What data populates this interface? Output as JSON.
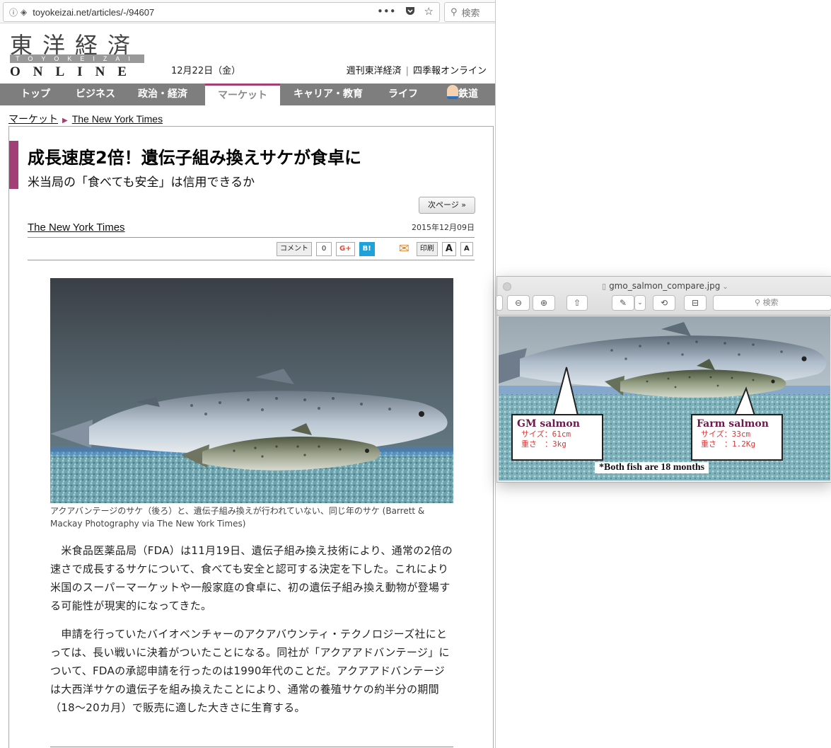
{
  "browser": {
    "url": "toyokeizai.net/articles/-/94607",
    "search_placeholder": "検索",
    "icons": [
      "info-icon",
      "shield-icon",
      "more-icon",
      "pocket-icon",
      "star-icon",
      "search-icon"
    ],
    "more_glyph": "•••"
  },
  "site": {
    "logo_kanji": "東洋経済",
    "logo_band": "TOYOKEIZAI",
    "logo_online": "ONLINE",
    "date": "12月22日（金）",
    "top_links": [
      "週刊東洋経済",
      "四季報オンライン"
    ],
    "nav": [
      "トップ",
      "ビジネス",
      "政治・経済",
      "マーケット",
      "キャリア・教育",
      "ライフ",
      "鉄道"
    ],
    "nav_active_index": 3,
    "accent_color": "#a23f77"
  },
  "breadcrumb": [
    "マーケット",
    "The New York Times"
  ],
  "article": {
    "title": "成長速度2倍！遺伝子組み換えサケが食卓に",
    "subtitle": "米当局の「食べても安全」は信用できるか",
    "next_page": "次ページ »",
    "source": "The New York Times",
    "date": "2015年12月09日",
    "share": {
      "comment": "コメント",
      "comment_count": "0",
      "gplus": "G+",
      "hatena": "B!",
      "print": "印刷",
      "font_large": "A",
      "font_small": "A"
    },
    "caption": "アクアバンテージのサケ（後ろ）と、遺伝子組み換えが行われていない、同じ年のサケ (Barrett & Mackay Photography via The New York Times)",
    "paragraphs": [
      "米食品医薬品局（FDA）は11月19日、遺伝子組み換え技術により、通常の2倍の速さで成長するサケについて、食べても安全と認可する決定を下した。これにより米国のスーパーマーケットや一般家庭の食卓に、初の遺伝子組み換え動物が登場する可能性が現実的になってきた。",
      "申請を行っていたバイオベンチャーのアクアバウンティ・テクノロジーズ社にとっては、長い戦いに決着がついたことになる。同社が「アクアアドバンテージ」について、FDAの承認申請を行ったのは1990年代のことだ。アクアアドバンテージは大西洋サケの遺伝子を組み換えたことにより、通常の養殖サケの約半分の期間（18〜20カ月）で販売に適した大きさに生育する。"
    ]
  },
  "preview": {
    "filename": "gmo_salmon_compare.jpg",
    "search_placeholder": "検索",
    "gm": {
      "name": "GM salmon",
      "size_label": "サイズ：61cm",
      "weight_label": "重さ　：3kg"
    },
    "farm": {
      "name": "Farm salmon",
      "size_label": "サイズ：33cm",
      "weight_label": "重さ　：1.2Kg"
    },
    "footnote": "*Both fish are 18 months"
  }
}
